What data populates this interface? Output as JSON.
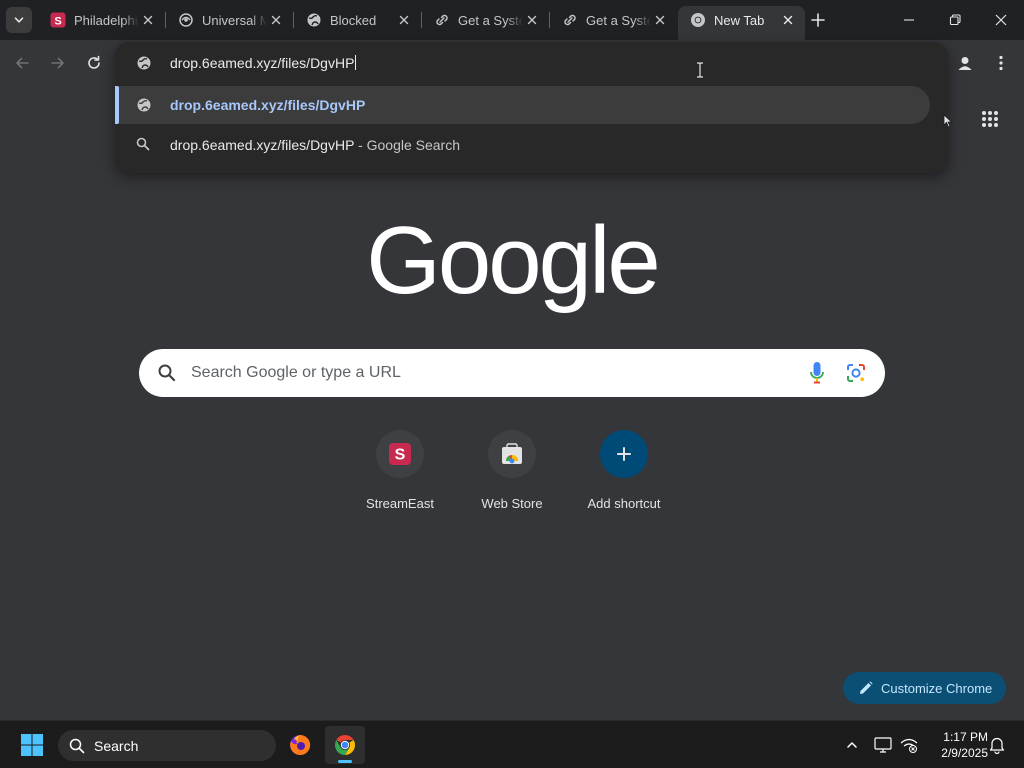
{
  "tabs": [
    {
      "title": "Philadelphia",
      "favicon": "streameast-favicon"
    },
    {
      "title": "Universal Media",
      "favicon": "swirl-favicon"
    },
    {
      "title": "Blocked",
      "favicon": "globe-favicon"
    },
    {
      "title": "Get a System",
      "favicon": "link-favicon"
    },
    {
      "title": "Get a System",
      "favicon": "link-favicon"
    },
    {
      "title": "New Tab",
      "favicon": "chrome-favicon"
    }
  ],
  "omnibox": {
    "input_value": "drop.6eamed.xyz/files/DgvHP",
    "suggestions": [
      {
        "text": "drop.6eamed.xyz/files/DgvHP",
        "icon": "globe-icon",
        "selected": true
      },
      {
        "text": "drop.6eamed.xyz/files/DgvHP",
        "suffix": " - Google Search",
        "icon": "search-icon",
        "selected": false
      }
    ]
  },
  "logo": {
    "text": "Google"
  },
  "search": {
    "placeholder": "Search Google or type a URL"
  },
  "shortcuts": [
    {
      "label": "StreamEast",
      "icon": "streameast-icon"
    },
    {
      "label": "Web Store",
      "icon": "webstore-icon"
    },
    {
      "label": "Add shortcut",
      "icon": "plus-icon"
    }
  ],
  "customize": {
    "label": "Customize Chrome"
  },
  "taskbar": {
    "search_label": "Search",
    "time": "1:17 PM",
    "date": "2/9/2025"
  },
  "colors": {
    "tab_strip": "#202124",
    "page_bg": "#35363a",
    "accent": "#a8c7fa",
    "customize_bg": "#0b4f75"
  }
}
